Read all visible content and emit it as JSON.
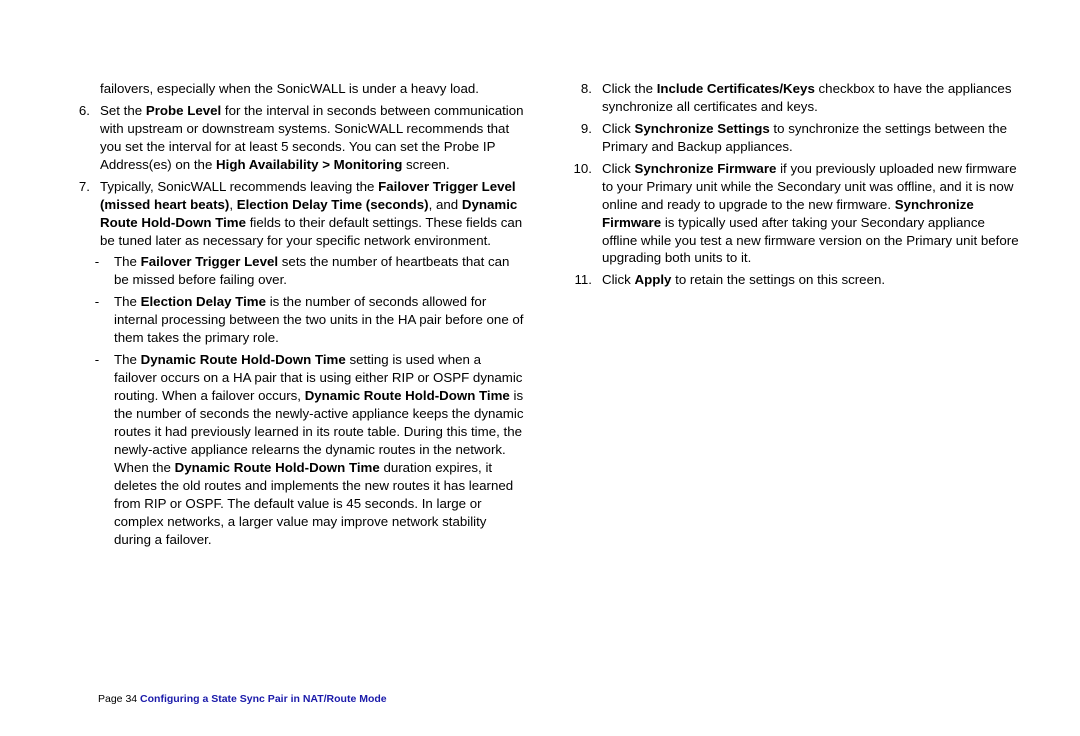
{
  "left": {
    "intro": "failovers, especially when the SonicWALL is under a heavy load.",
    "item6_num": "6.",
    "item6_a": "Set the ",
    "item6_b": "Probe Level",
    "item6_c": " for the interval in seconds between communication with upstream or downstream systems. SonicWALL recommends that you set the interval for at least 5 seconds. You can set the Probe IP Address(es) on the ",
    "item6_d": "High Availability > Monitoring",
    "item6_e": " screen.",
    "item7_num": "7.",
    "item7_a": "Typically, SonicWALL recommends leaving the ",
    "item7_b": "Failover Trigger Level (missed heart beats)",
    "item7_c": ", ",
    "item7_d": "Election Delay Time (seconds)",
    "item7_e": ", and ",
    "item7_f": "Dynamic Route Hold-Down Time",
    "item7_g": " fields to their default settings. These fields can be tuned later as necessary for your specific network environment.",
    "sub1_dash": "-",
    "sub1_a": "The ",
    "sub1_b": "Failover Trigger Level",
    "sub1_c": " sets the number of heartbeats that can be missed before failing over.",
    "sub2_dash": "-",
    "sub2_a": "The ",
    "sub2_b": "Election Delay Time",
    "sub2_c": " is the number of seconds allowed for internal processing between the two units in the HA pair before one of them takes the primary role.",
    "sub3_dash": "-",
    "sub3_a": "The ",
    "sub3_b": "Dynamic Route Hold-Down Time",
    "sub3_c": " setting is used when a failover occurs on a HA pair that is using either RIP or OSPF dynamic routing. When a failover occurs, ",
    "sub3_d": "Dynamic Route Hold-Down Time",
    "sub3_e": " is the number of seconds the newly-active appliance keeps the dynamic routes it had previously learned in its route table. During this time, the newly-active appliance relearns the dynamic routes in the network. When the ",
    "sub3_f": "Dynamic Route Hold-Down Time",
    "sub3_g": " duration expires, it deletes the old routes and implements the new routes it has learned from RIP or OSPF. The default value is 45 seconds. In large or complex networks, a larger value may improve network stability during a failover."
  },
  "right": {
    "item8_num": "8.",
    "item8_a": "Click the ",
    "item8_b": "Include Certificates/Keys",
    "item8_c": " checkbox to have the appliances synchronize all certificates and keys.",
    "item9_num": "9.",
    "item9_a": "Click ",
    "item9_b": "Synchronize Settings",
    "item9_c": " to synchronize the settings between the Primary and Backup appliances.",
    "item10_num": "10.",
    "item10_a": "Click ",
    "item10_b": "Synchronize Firmware",
    "item10_c": " if you previously uploaded new firmware to your Primary unit while the Secondary unit was offline, and it is now online and ready to upgrade to the new firmware. ",
    "item10_d": "Synchronize Firmware",
    "item10_e": " is typically used after taking your Secondary appliance offline while you test a new firmware version on the Primary unit before upgrading both units to it.",
    "item11_num": "11.",
    "item11_a": "Click ",
    "item11_b": "Apply",
    "item11_c": " to retain the settings on this screen."
  },
  "footer": {
    "page": "Page 34  ",
    "title": "Configuring a State Sync Pair in NAT/Route Mode"
  }
}
